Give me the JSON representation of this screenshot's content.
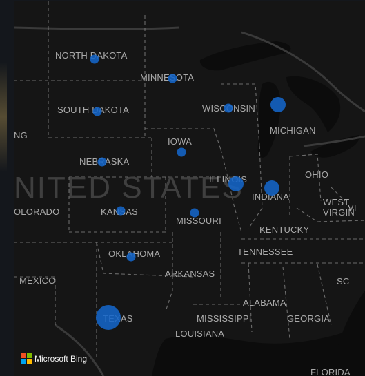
{
  "map": {
    "country_label": "NITED STATES",
    "states": [
      {
        "key": "nd",
        "label": "NORTH DAKOTA"
      },
      {
        "key": "sd",
        "label": "SOUTH DAKOTA"
      },
      {
        "key": "mn",
        "label": "MINNESOTA"
      },
      {
        "key": "wi",
        "label": "WISCONSIN"
      },
      {
        "key": "mi",
        "label": "MICHIGAN"
      },
      {
        "key": "ia",
        "label": "IOWA"
      },
      {
        "key": "ne",
        "label": "NEBRASKA"
      },
      {
        "key": "il",
        "label": "ILLINOIS"
      },
      {
        "key": "in",
        "label": "INDIANA"
      },
      {
        "key": "oh",
        "label": "OHIO"
      },
      {
        "key": "ks",
        "label": "KANSAS"
      },
      {
        "key": "mo",
        "label": "MISSOURI"
      },
      {
        "key": "co",
        "label": "OLORADO"
      },
      {
        "key": "wy",
        "label": "NG"
      },
      {
        "key": "ky",
        "label": "KENTUCKY"
      },
      {
        "key": "wv",
        "label": "WEST\nVIRGIN"
      },
      {
        "key": "va",
        "label": "VI"
      },
      {
        "key": "tn",
        "label": "TENNESSEE"
      },
      {
        "key": "ok",
        "label": "OKLAHOMA"
      },
      {
        "key": "ar",
        "label": "ARKANSAS"
      },
      {
        "key": "nm",
        "label": "MEXICO"
      },
      {
        "key": "sc",
        "label": "SC"
      },
      {
        "key": "al",
        "label": "ALABAMA"
      },
      {
        "key": "ga",
        "label": "GEORGIA"
      },
      {
        "key": "ms",
        "label": "MISSISSIPPI"
      },
      {
        "key": "tx",
        "label": "TEXAS"
      },
      {
        "key": "la",
        "label": "LOUISIANA"
      },
      {
        "key": "fl",
        "label": "FLORIDA"
      }
    ],
    "bubbles": [
      {
        "key": "nd",
        "size": "small"
      },
      {
        "key": "mn",
        "size": "small"
      },
      {
        "key": "sd",
        "size": "small"
      },
      {
        "key": "wi",
        "size": "small"
      },
      {
        "key": "mi",
        "size": "medium"
      },
      {
        "key": "ia",
        "size": "small"
      },
      {
        "key": "ne",
        "size": "small"
      },
      {
        "key": "il",
        "size": "medium"
      },
      {
        "key": "in",
        "size": "medium"
      },
      {
        "key": "ks",
        "size": "small"
      },
      {
        "key": "mo",
        "size": "small"
      },
      {
        "key": "ok",
        "size": "small"
      },
      {
        "key": "tx",
        "size": "large"
      }
    ],
    "bubble_color": "#1565c8"
  },
  "attribution": {
    "brand": "Microsoft Bing",
    "logo_colors": [
      "#f25022",
      "#7fba00",
      "#00a4ef",
      "#ffb900"
    ]
  }
}
